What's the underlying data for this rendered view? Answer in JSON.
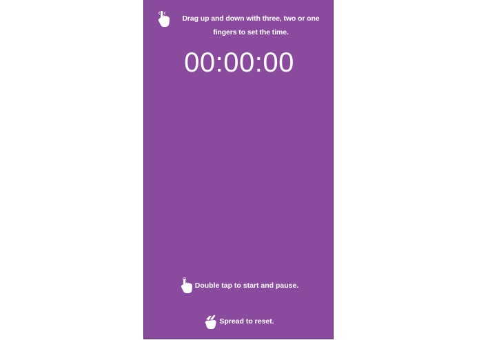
{
  "hints": {
    "set_time": "Drag up and down with three, two or one fingers to set the time.",
    "start_pause": "Double tap to start and pause.",
    "reset": "Spread to reset."
  },
  "timer": {
    "display": "00:00:00"
  },
  "icons": {
    "drag": "hand-drag-icon",
    "double_tap": "hand-tap-icon",
    "spread": "hand-spread-icon"
  },
  "colors": {
    "background": "#8a4a9e",
    "text": "#ffffff"
  }
}
